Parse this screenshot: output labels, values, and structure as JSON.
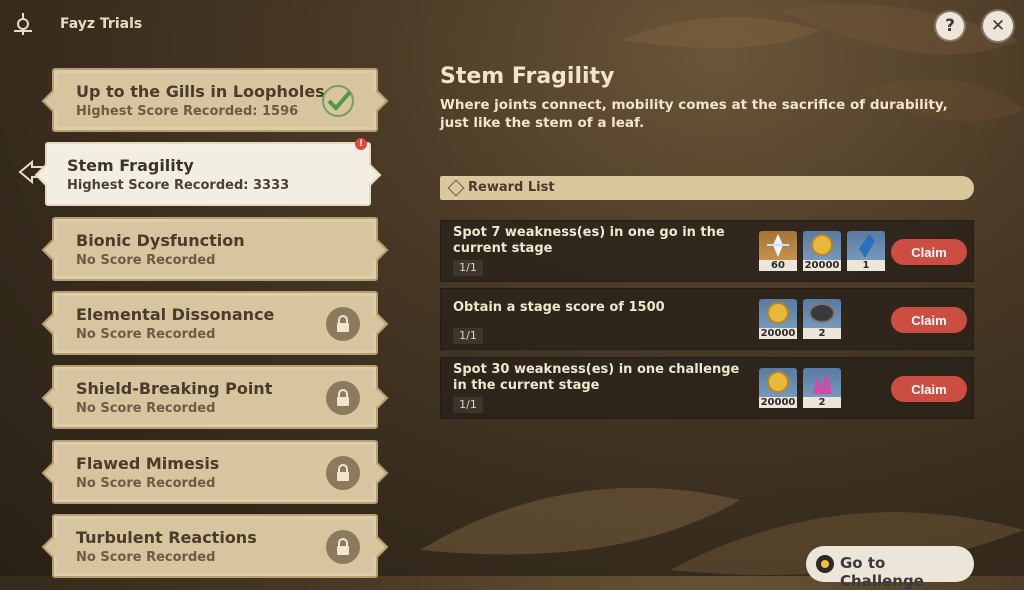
{
  "window": {
    "title": "Fayz Trials"
  },
  "top_buttons": {
    "help": "?",
    "close": "✕"
  },
  "trials": [
    {
      "name": "Up to the Gills in Loopholes",
      "score": "Highest Score Recorded: 1596",
      "state": "completed"
    },
    {
      "name": "Stem Fragility",
      "score": "Highest Score Recorded: 3333",
      "state": "selected",
      "badge": "!"
    },
    {
      "name": "Bionic Dysfunction",
      "score": "No Score Recorded",
      "state": "unlocked"
    },
    {
      "name": "Elemental Dissonance",
      "score": "No Score Recorded",
      "state": "locked"
    },
    {
      "name": "Shield-Breaking Point",
      "score": "No Score Recorded",
      "state": "locked"
    },
    {
      "name": "Flawed Mimesis",
      "score": "No Score Recorded",
      "state": "locked"
    },
    {
      "name": "Turbulent Reactions",
      "score": "No Score Recorded",
      "state": "locked"
    }
  ],
  "detail": {
    "title": "Stem Fragility",
    "description": "Where joints connect, mobility comes at the sacrifice of durability, just like the stem of a leaf.",
    "reward_list_label": "Reward List",
    "rewards": [
      {
        "text": "Spot 7 weakness(es) in one go in the current stage",
        "progress": "1/1",
        "items": [
          {
            "icon": "primogem-icon",
            "qty": "60"
          },
          {
            "icon": "mora-icon",
            "qty": "20000"
          },
          {
            "icon": "crystal-icon",
            "qty": "1"
          }
        ],
        "claim": "Claim"
      },
      {
        "text": "Obtain a stage score of 1500",
        "progress": "1/1",
        "items": [
          {
            "icon": "mora-icon",
            "qty": "20000"
          },
          {
            "icon": "ore-icon",
            "qty": "2"
          }
        ],
        "claim": "Claim"
      },
      {
        "text": "Spot 30 weakness(es) in one challenge in the current stage",
        "progress": "1/1",
        "items": [
          {
            "icon": "mora-icon",
            "qty": "20000"
          },
          {
            "icon": "crystal-chunk-icon",
            "qty": "2"
          }
        ],
        "claim": "Claim"
      }
    ]
  },
  "go_button": "Go to Challenge"
}
